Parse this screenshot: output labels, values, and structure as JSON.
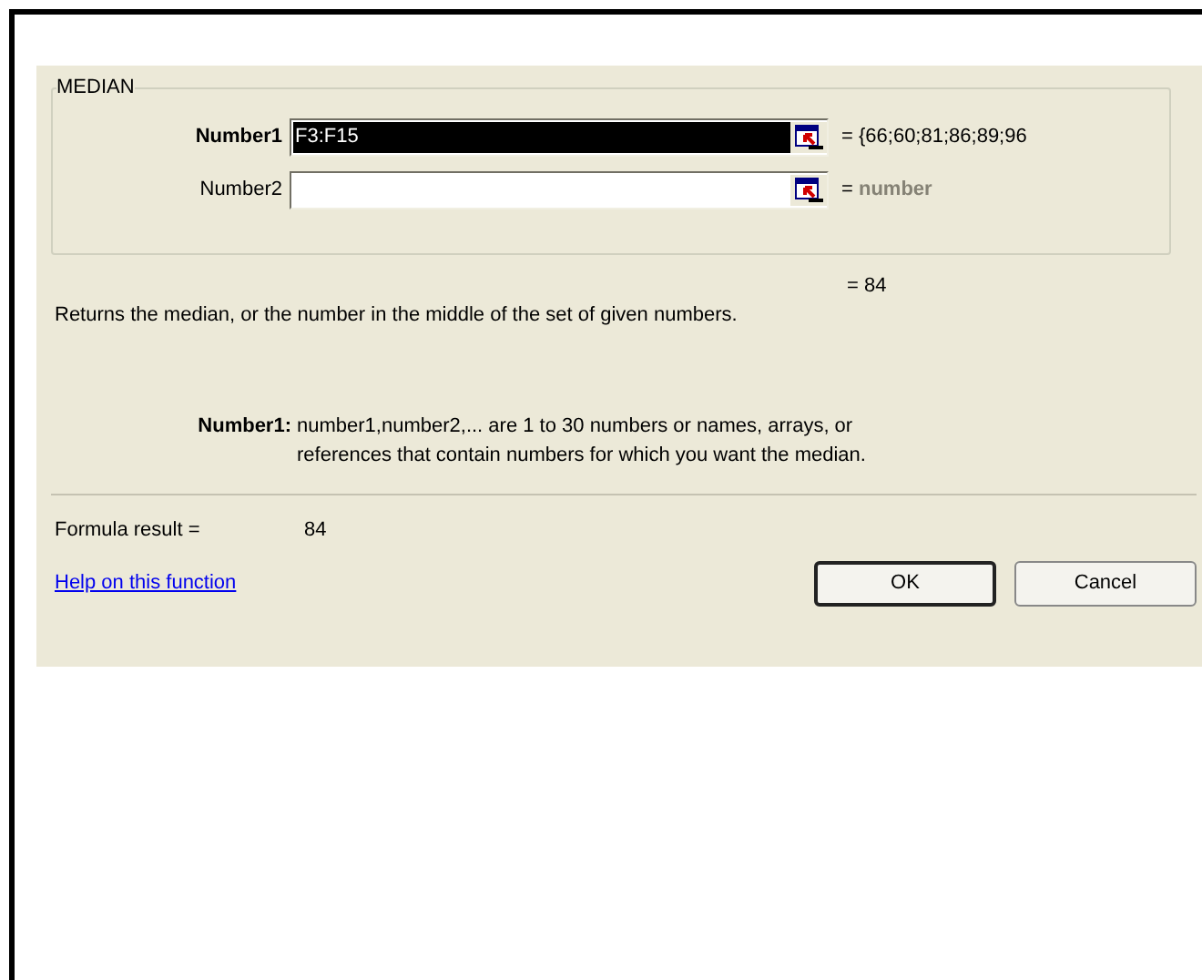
{
  "group_title": "MEDIAN",
  "arguments": [
    {
      "label": "Number1",
      "value": "F3:F15",
      "selected": true,
      "result": "= {66;60;81;86;89;96"
    },
    {
      "label": "Number2",
      "selected": false,
      "result": "= ",
      "hint": "number"
    }
  ],
  "function_result": "= 84",
  "description": "Returns the median, or the number in the middle of the set of given numbers.",
  "argument_help": {
    "label": "Number1:",
    "text": "number1,number2,... are 1 to 30 numbers or names, arrays, or references that contain numbers for which you want the median."
  },
  "formula_result": {
    "label": "Formula result =",
    "value": "84"
  },
  "help_link": "Help on this function",
  "buttons": [
    {
      "label": "OK",
      "selected": true
    },
    {
      "label": "Cancel",
      "selected": false
    }
  ]
}
